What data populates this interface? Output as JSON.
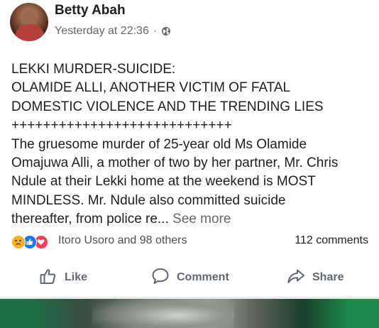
{
  "post": {
    "author": "Betty Abah",
    "timestamp": "Yesterday at 22:36",
    "separator": "·",
    "privacy_icon": "globe-icon",
    "text_lines": [
      "LEKKI MURDER-SUICIDE:",
      "OLAMIDE ALLI, ANOTHER VICTIM OF FATAL",
      "DOMESTIC VIOLENCE AND THE TRENDING LIES",
      "++++++++++++++++++++++++++++",
      "The gruesome murder of 25-year old Ms Olamide",
      "Omajuwa Alli, a mother of two by her partner, Mr. Chris",
      "Ndule at their Lekki home at the weekend is MOST",
      "MINDLESS. Mr. Ndule also committed suicide",
      "thereafter, from police re..."
    ],
    "see_more": "See more"
  },
  "engagement": {
    "reaction_icons": [
      "sad-reaction-icon",
      "like-reaction-icon",
      "love-reaction-icon"
    ],
    "reactors": "Itoro Usoro and 98 others",
    "comments": "112 comments"
  },
  "actions": {
    "like": "Like",
    "comment": "Comment",
    "share": "Share"
  },
  "colors": {
    "text": "#1c1e21",
    "meta": "#65676b",
    "like_blue": "#1877f2",
    "love_red": "#f33e58",
    "sad_yellow": "#f7b125"
  }
}
